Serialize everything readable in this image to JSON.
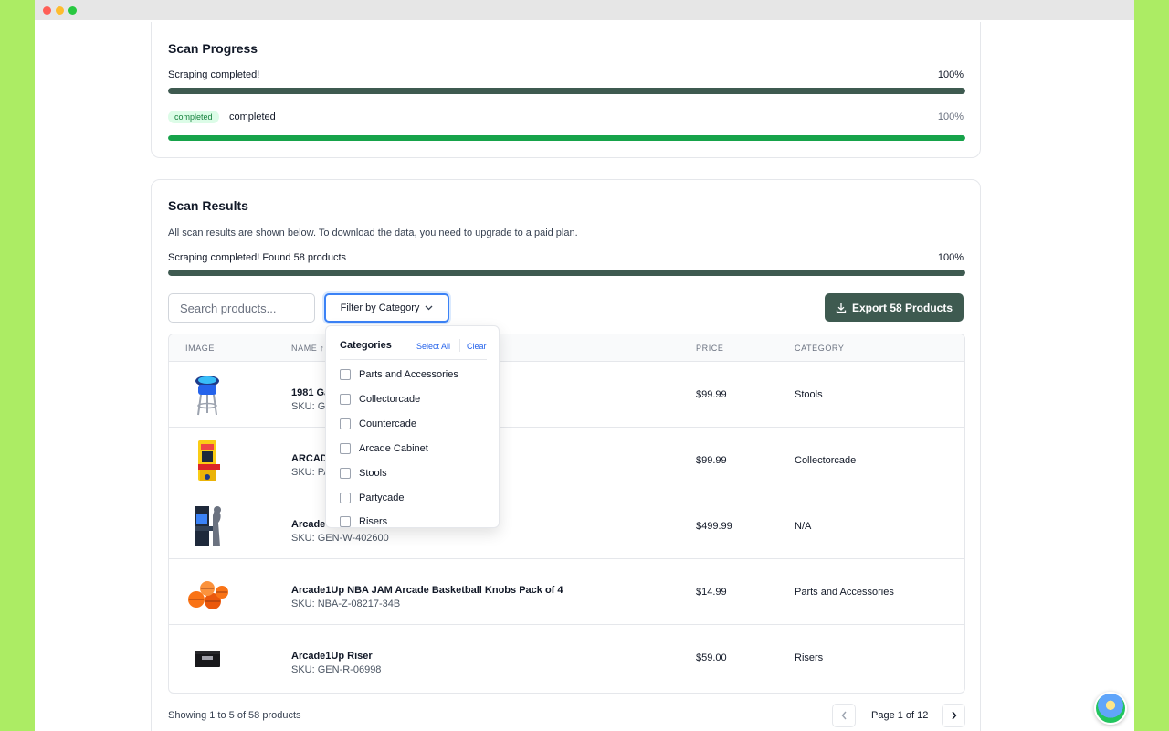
{
  "scan_progress": {
    "title": "Scan Progress",
    "status_text": "Scraping completed!",
    "status_percent": "100%",
    "status_progress": 1.0,
    "badge": "completed",
    "sub_status": "completed",
    "sub_percent": "100%",
    "sub_progress": 1.0
  },
  "scan_results": {
    "title": "Scan Results",
    "description": "All scan results are shown below. To download the data, you need to upgrade to a paid plan.",
    "status_text": "Scraping completed! Found 58 products",
    "status_percent": "100%",
    "status_progress": 1.0
  },
  "toolbar": {
    "search_placeholder": "Search products...",
    "filter_label": "Filter by Category",
    "export_label": "Export 58 Products"
  },
  "table": {
    "headers": {
      "image": "IMAGE",
      "name": "NAME ↑",
      "price": "PRICE",
      "category": "CATEGORY"
    },
    "rows": [
      {
        "name": "1981 Ga",
        "sku": "SKU: Ga",
        "price": "$99.99",
        "category": "Stools"
      },
      {
        "name": "ARCADI",
        "sku": "SKU: PA",
        "price": "$99.99",
        "category": "Collectorcade"
      },
      {
        "name": "Arcade",
        "sku": "SKU: GEN-W-402600",
        "price": "$499.99",
        "category": "N/A"
      },
      {
        "name": "Arcade1Up NBA JAM Arcade Basketball Knobs Pack of 4",
        "sku": "SKU: NBA-Z-08217-34B",
        "price": "$14.99",
        "category": "Parts and Accessories"
      },
      {
        "name": "Arcade1Up Riser",
        "sku": "SKU: GEN-R-06998",
        "price": "$59.00",
        "category": "Risers"
      }
    ]
  },
  "dropdown": {
    "title": "Categories",
    "select_all": "Select All",
    "clear": "Clear",
    "items": [
      "Parts and Accessories",
      "Collectorcade",
      "Countercade",
      "Arcade Cabinet",
      "Stools",
      "Partycade",
      "Risers"
    ]
  },
  "pagination": {
    "showing": "Showing 1 to 5 of 58 products",
    "page_text": "Page 1 of 12",
    "prev_icon": "chevron-left-icon",
    "next_icon": "chevron-right-icon"
  },
  "colors": {
    "page_background": "#acec64",
    "primary": "#3e5a50",
    "success": "#16a34a",
    "accent_blue": "#3b82f6"
  }
}
